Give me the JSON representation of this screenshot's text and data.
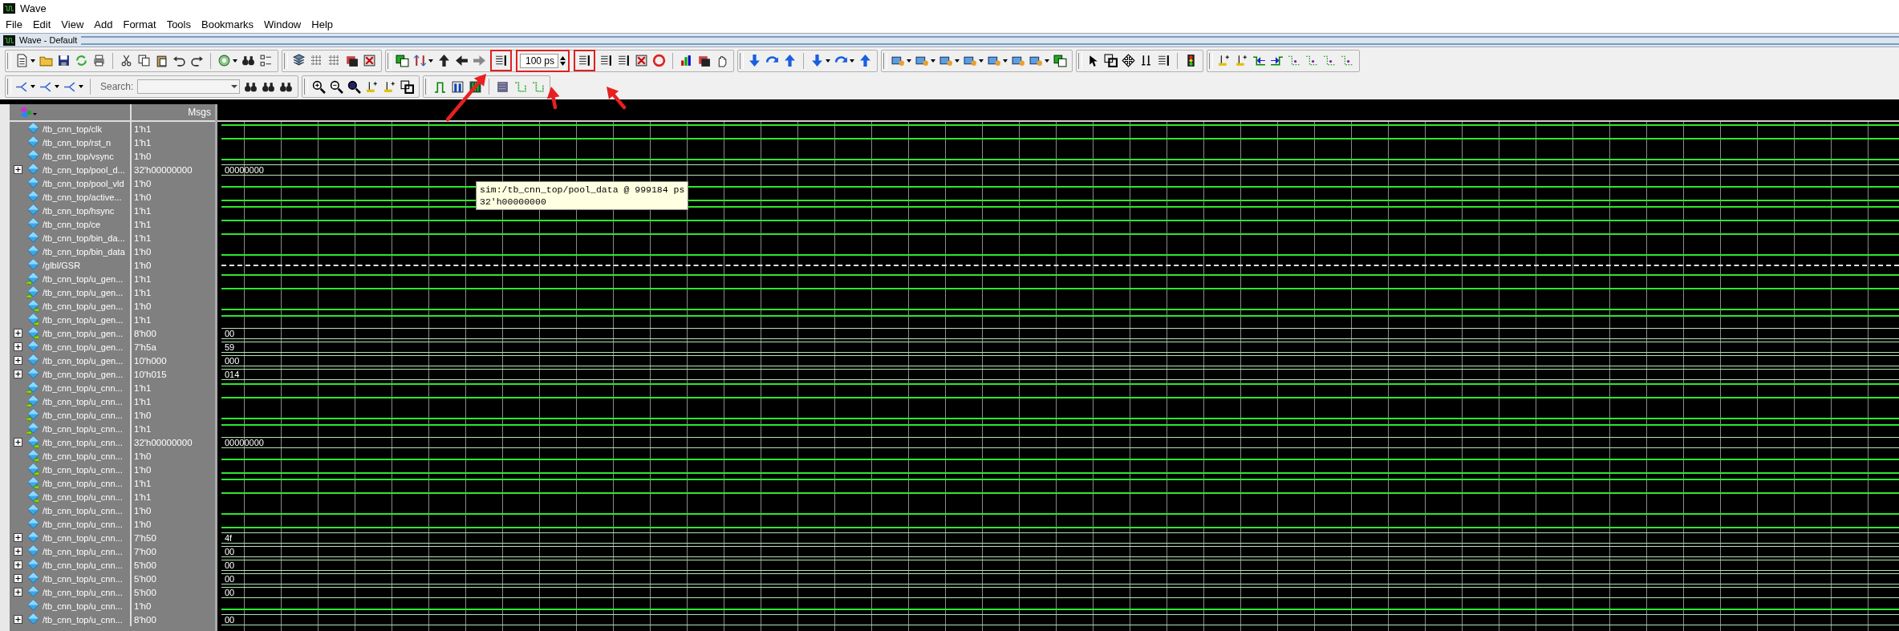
{
  "window": {
    "title": "Wave"
  },
  "menu": [
    "File",
    "Edit",
    "View",
    "Add",
    "Format",
    "Tools",
    "Bookmarks",
    "Window",
    "Help"
  ],
  "pane": {
    "title": "Wave - Default"
  },
  "toolbar": {
    "time_value": "100 ps",
    "search_label": "Search:"
  },
  "columns": {
    "values": "Msgs"
  },
  "signals": [
    {
      "name": "/tb_cnn_top/clk",
      "value": "1'h1",
      "kind": "high"
    },
    {
      "name": "/tb_cnn_top/rst_n",
      "value": "1'h1",
      "kind": "high"
    },
    {
      "name": "/tb_cnn_top/vsync",
      "value": "1'h0",
      "kind": "low"
    },
    {
      "name": "/tb_cnn_top/pool_d...",
      "value": "32'h00000000",
      "kind": "bus",
      "bus_label": "00000000",
      "expanded": false
    },
    {
      "name": "/tb_cnn_top/pool_vld",
      "value": "1'h0",
      "kind": "low"
    },
    {
      "name": "/tb_cnn_top/active...",
      "value": "1'h0",
      "kind": "low"
    },
    {
      "name": "/tb_cnn_top/hsync",
      "value": "1'h1",
      "kind": "high"
    },
    {
      "name": "/tb_cnn_top/ce",
      "value": "1'h1",
      "kind": "high"
    },
    {
      "name": "/tb_cnn_top/bin_da...",
      "value": "1'h1",
      "kind": "high"
    },
    {
      "name": "/tb_cnn_top/bin_data",
      "value": "1'h0",
      "kind": "low"
    },
    {
      "name": "/glbl/GSR",
      "value": "1'h0",
      "kind": "dashed"
    },
    {
      "name": "/tb_cnn_top/u_gen...",
      "value": "1'h1",
      "kind": "inhigh"
    },
    {
      "name": "/tb_cnn_top/u_gen...",
      "value": "1'h1",
      "kind": "inhigh"
    },
    {
      "name": "/tb_cnn_top/u_gen...",
      "value": "1'h0",
      "kind": "outlow"
    },
    {
      "name": "/tb_cnn_top/u_gen...",
      "value": "1'h1",
      "kind": "outhigh"
    },
    {
      "name": "/tb_cnn_top/u_gen...",
      "value": "8'h00",
      "kind": "outbus",
      "bus_label": "00",
      "expanded": false
    },
    {
      "name": "/tb_cnn_top/u_gen...",
      "value": "7'h5a",
      "kind": "bus",
      "bus_label": "59",
      "expanded": false
    },
    {
      "name": "/tb_cnn_top/u_gen...",
      "value": "10'h000",
      "kind": "bus",
      "bus_label": "000",
      "expanded": false
    },
    {
      "name": "/tb_cnn_top/u_gen...",
      "value": "10'h015",
      "kind": "bus",
      "bus_label": "014",
      "expanded": false
    },
    {
      "name": "/tb_cnn_top/u_cnn...",
      "value": "1'h1",
      "kind": "inhigh"
    },
    {
      "name": "/tb_cnn_top/u_cnn...",
      "value": "1'h1",
      "kind": "inhigh"
    },
    {
      "name": "/tb_cnn_top/u_cnn...",
      "value": "1'h0",
      "kind": "inlow"
    },
    {
      "name": "/tb_cnn_top/u_cnn...",
      "value": "1'h1",
      "kind": "inhigh"
    },
    {
      "name": "/tb_cnn_top/u_cnn...",
      "value": "32'h00000000",
      "kind": "outbus",
      "bus_label": "00000000",
      "expanded": false
    },
    {
      "name": "/tb_cnn_top/u_cnn...",
      "value": "1'h0",
      "kind": "outlow"
    },
    {
      "name": "/tb_cnn_top/u_cnn...",
      "value": "1'h0",
      "kind": "outlow"
    },
    {
      "name": "/tb_cnn_top/u_cnn...",
      "value": "1'h1",
      "kind": "outhigh"
    },
    {
      "name": "/tb_cnn_top/u_cnn...",
      "value": "1'h1",
      "kind": "outhigh"
    },
    {
      "name": "/tb_cnn_top/u_cnn...",
      "value": "1'h0",
      "kind": "low"
    },
    {
      "name": "/tb_cnn_top/u_cnn...",
      "value": "1'h0",
      "kind": "low"
    },
    {
      "name": "/tb_cnn_top/u_cnn...",
      "value": "7'h50",
      "kind": "bus",
      "bus_label": "4f",
      "expanded": false
    },
    {
      "name": "/tb_cnn_top/u_cnn...",
      "value": "7'h00",
      "kind": "bus",
      "bus_label": "00",
      "expanded": false
    },
    {
      "name": "/tb_cnn_top/u_cnn...",
      "value": "5'h00",
      "kind": "bus",
      "bus_label": "00",
      "expanded": false
    },
    {
      "name": "/tb_cnn_top/u_cnn...",
      "value": "5'h00",
      "kind": "bus",
      "bus_label": "00",
      "expanded": false
    },
    {
      "name": "/tb_cnn_top/u_cnn...",
      "value": "5'h00",
      "kind": "bus",
      "bus_label": "00",
      "expanded": false
    },
    {
      "name": "/tb_cnn_top/u_cnn...",
      "value": "1'h0",
      "kind": "low"
    },
    {
      "name": "/tb_cnn_top/u_cnn...",
      "value": "8'h00",
      "kind": "bus",
      "bus_label": "00",
      "expanded": false
    }
  ],
  "tooltip": {
    "lines": [
      "sim:/tb_cnn_top/pool_data @ 999184 ps",
      "32'h00000000"
    ]
  }
}
